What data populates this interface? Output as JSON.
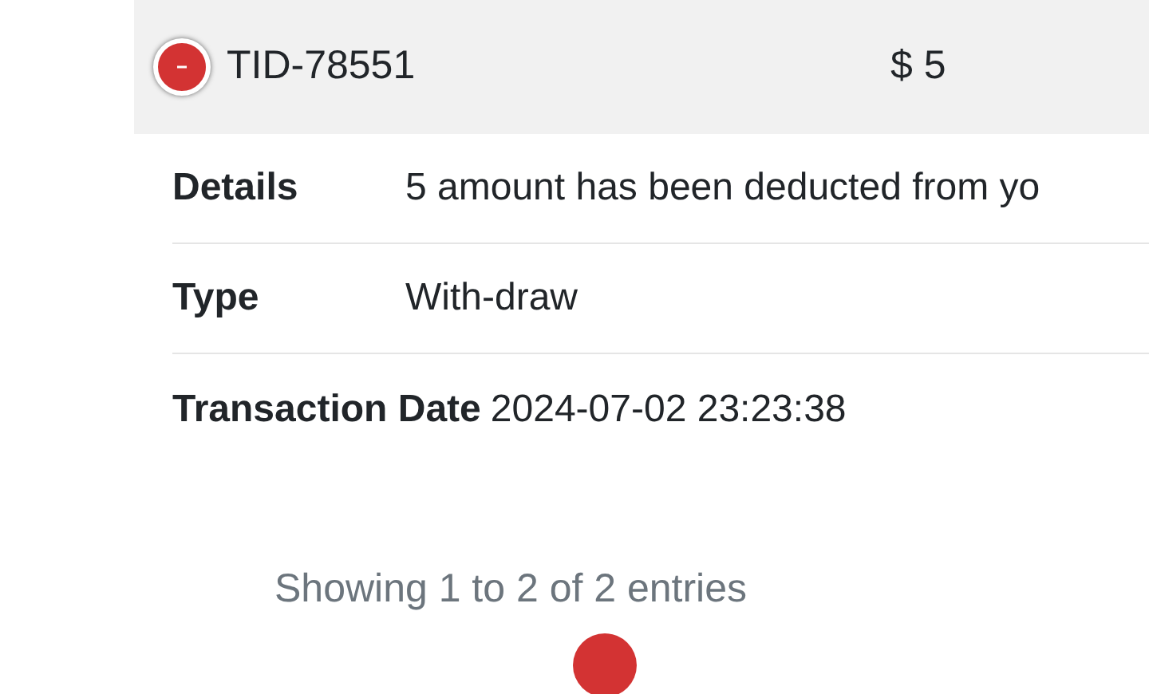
{
  "transaction": {
    "id": "TID-78551",
    "amount": "$ 5",
    "expanded": true
  },
  "details": [
    {
      "label": "Details",
      "value": "5 amount has been deducted from yo"
    },
    {
      "label": "Type",
      "value": "With-draw"
    },
    {
      "label": "Transaction Date",
      "value": "2024-07-02 23:23:38"
    }
  ],
  "footer": {
    "info": "Showing 1 to 2 of 2 entries"
  }
}
